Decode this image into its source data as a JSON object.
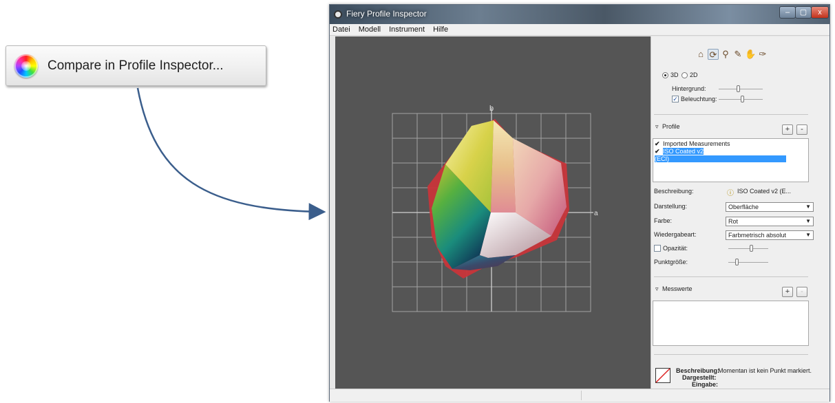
{
  "callout": {
    "label": "Compare in Profile Inspector..."
  },
  "window": {
    "title": "Fiery Profile Inspector",
    "controls": {
      "minimize": "–",
      "maximize": "▢",
      "close": "x"
    }
  },
  "menu": [
    {
      "label": "Datei"
    },
    {
      "label": "Modell"
    },
    {
      "label": "Instrument"
    },
    {
      "label": "Hilfe"
    }
  ],
  "viewport": {
    "axis_b": "b",
    "axis_a": "a"
  },
  "panel": {
    "view": {
      "radio_3d": "3D",
      "radio_2d": "2D",
      "selected": "3D"
    },
    "background_label": "Hintergrund:",
    "lighting_label": "Beleuchtung:",
    "lighting_checked": true,
    "profiles": {
      "header": "Profile",
      "add": "+",
      "remove": "-",
      "items": [
        {
          "label": "Imported Measurements",
          "checked": true,
          "selected": false
        },
        {
          "label": "ISO Coated v2 (ECI)",
          "checked": true,
          "selected": true
        }
      ]
    },
    "description_label": "Beschreibung:",
    "description_value": "ISO Coated v2 (E...",
    "display_label": "Darstellung:",
    "display_value": "Oberfläche",
    "color_label": "Farbe:",
    "color_value": "Rot",
    "rendering_label": "Wiedergabeart:",
    "rendering_value": "Farbmetrisch absolut",
    "opacity_label": "Opazität:",
    "point_size_label": "Punktgröße:",
    "measurements": {
      "header": "Messwerte",
      "add": "+",
      "remove": "-"
    },
    "info": {
      "description_label": "Beschreibung:",
      "description_value": "Momentan ist kein Punkt markiert.",
      "displayed_label": "Dargestellt:",
      "input_label": "Eingabe:"
    }
  },
  "colors": {
    "accent_selection": "#3399ff",
    "viewport_bg": "#555555",
    "arrow": "#3b5e8c"
  }
}
